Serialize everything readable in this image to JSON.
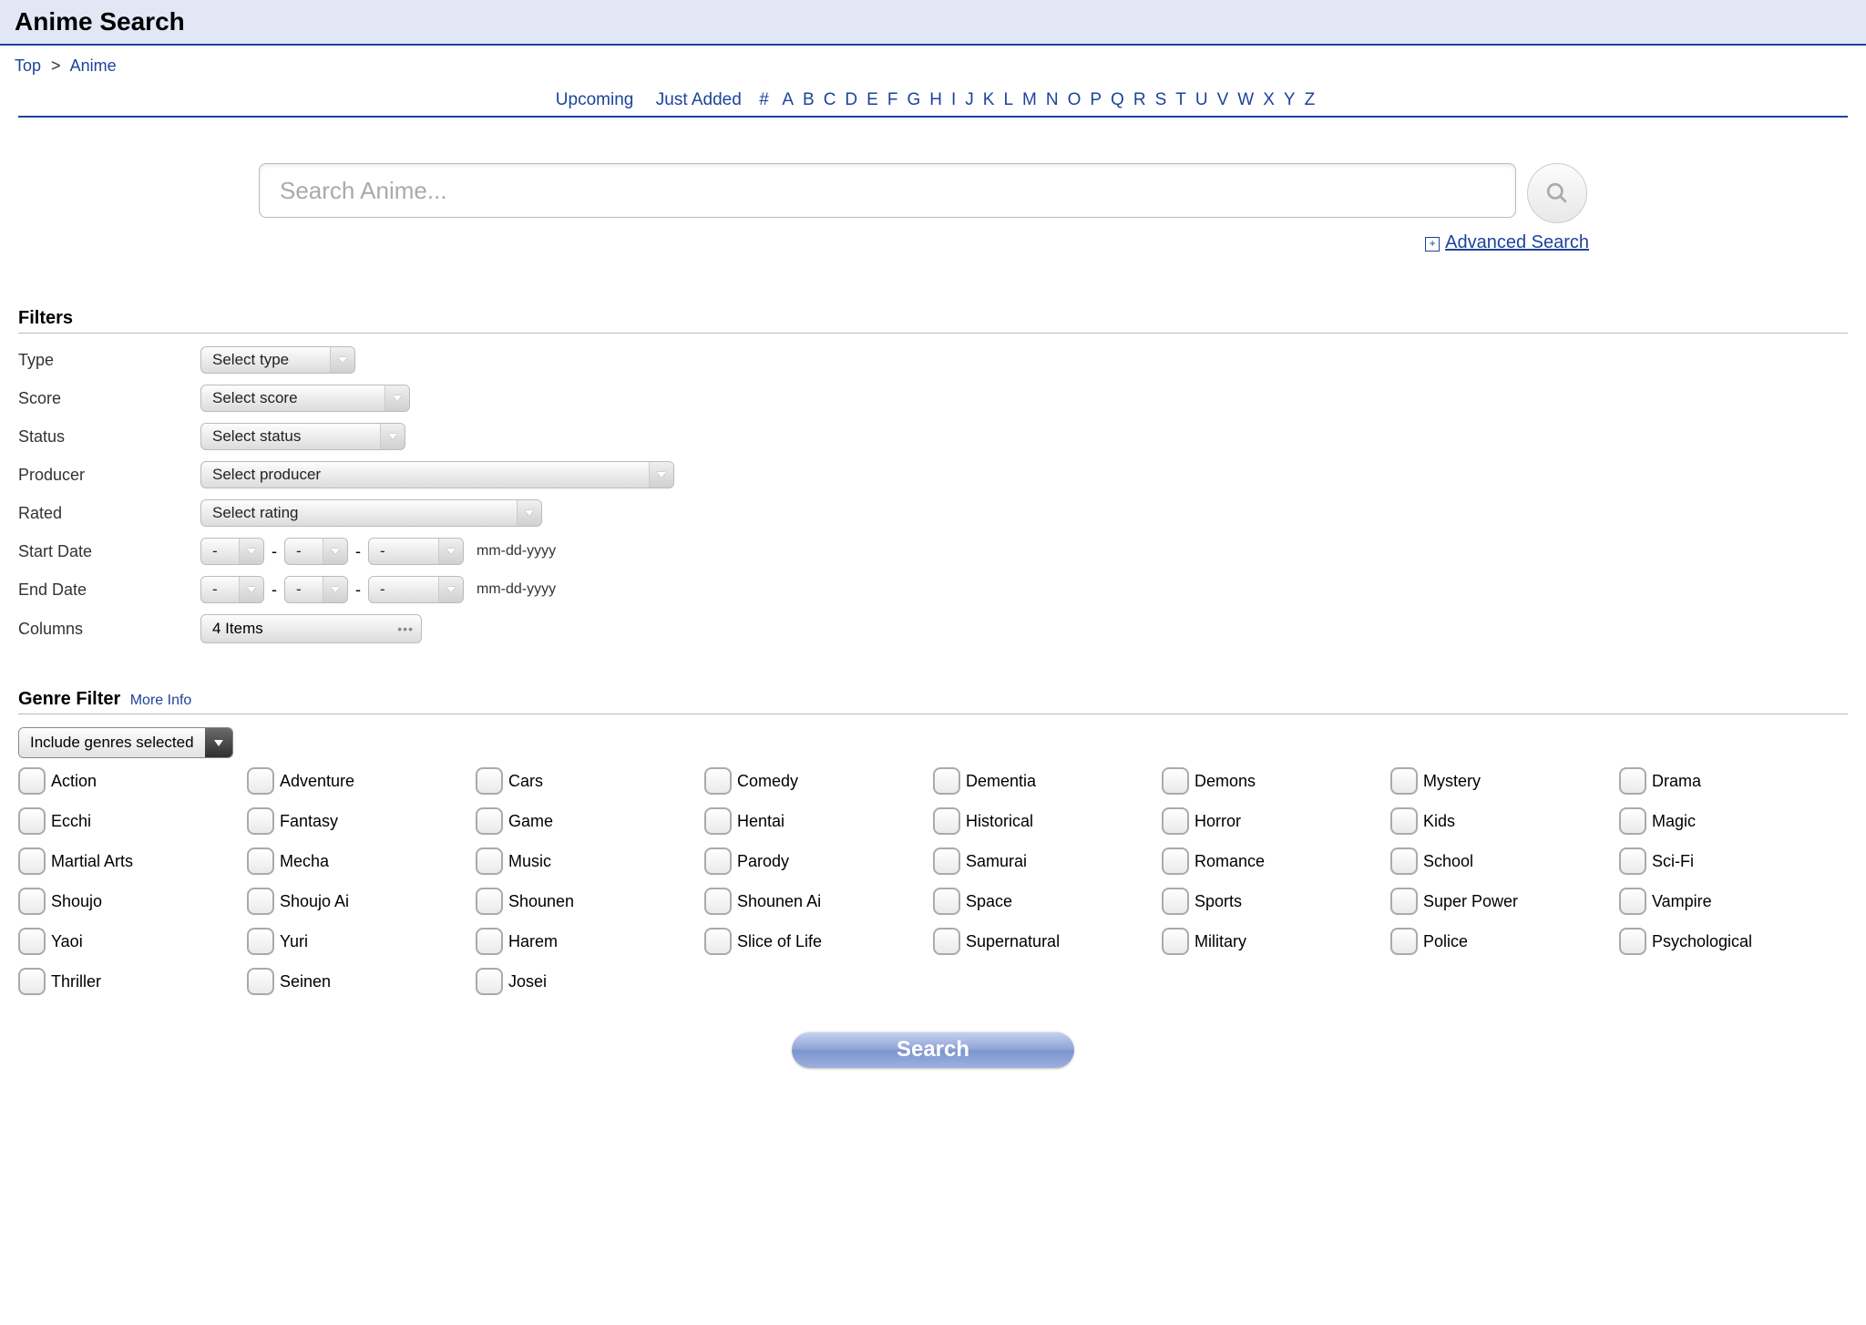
{
  "header": {
    "title": "Anime Search"
  },
  "breadcrumb": {
    "top": "Top",
    "sep": ">",
    "current": "Anime"
  },
  "alpha": {
    "upcoming": "Upcoming",
    "just_added": "Just Added",
    "hash": "#",
    "letters": [
      "A",
      "B",
      "C",
      "D",
      "E",
      "F",
      "G",
      "H",
      "I",
      "J",
      "K",
      "L",
      "M",
      "N",
      "O",
      "P",
      "Q",
      "R",
      "S",
      "T",
      "U",
      "V",
      "W",
      "X",
      "Y",
      "Z"
    ]
  },
  "search": {
    "placeholder": "Search Anime...",
    "advanced": "Advanced Search",
    "plus": "⊞"
  },
  "filters": {
    "title": "Filters",
    "rows": {
      "type": {
        "label": "Type",
        "value": "Select type"
      },
      "score": {
        "label": "Score",
        "value": "Select score"
      },
      "status": {
        "label": "Status",
        "value": "Select status"
      },
      "producer": {
        "label": "Producer",
        "value": "Select producer"
      },
      "rated": {
        "label": "Rated",
        "value": "Select rating"
      },
      "start": {
        "label": "Start Date",
        "m": "-",
        "d": "-",
        "y": "-",
        "hint": "mm-dd-yyyy"
      },
      "end": {
        "label": "End Date",
        "m": "-",
        "d": "-",
        "y": "-",
        "hint": "mm-dd-yyyy"
      },
      "columns": {
        "label": "Columns",
        "value": "4 Items"
      }
    }
  },
  "genre": {
    "title": "Genre Filter",
    "more_info": "More Info",
    "mode": "Include genres selected",
    "items": [
      "Action",
      "Adventure",
      "Cars",
      "Comedy",
      "Dementia",
      "Demons",
      "Mystery",
      "Drama",
      "Ecchi",
      "Fantasy",
      "Game",
      "Hentai",
      "Historical",
      "Horror",
      "Kids",
      "Magic",
      "Martial Arts",
      "Mecha",
      "Music",
      "Parody",
      "Samurai",
      "Romance",
      "School",
      "Sci-Fi",
      "Shoujo",
      "Shoujo Ai",
      "Shounen",
      "Shounen Ai",
      "Space",
      "Sports",
      "Super Power",
      "Vampire",
      "Yaoi",
      "Yuri",
      "Harem",
      "Slice of Life",
      "Supernatural",
      "Military",
      "Police",
      "Psychological",
      "Thriller",
      "Seinen",
      "Josei"
    ]
  },
  "action": {
    "search": "Search"
  }
}
